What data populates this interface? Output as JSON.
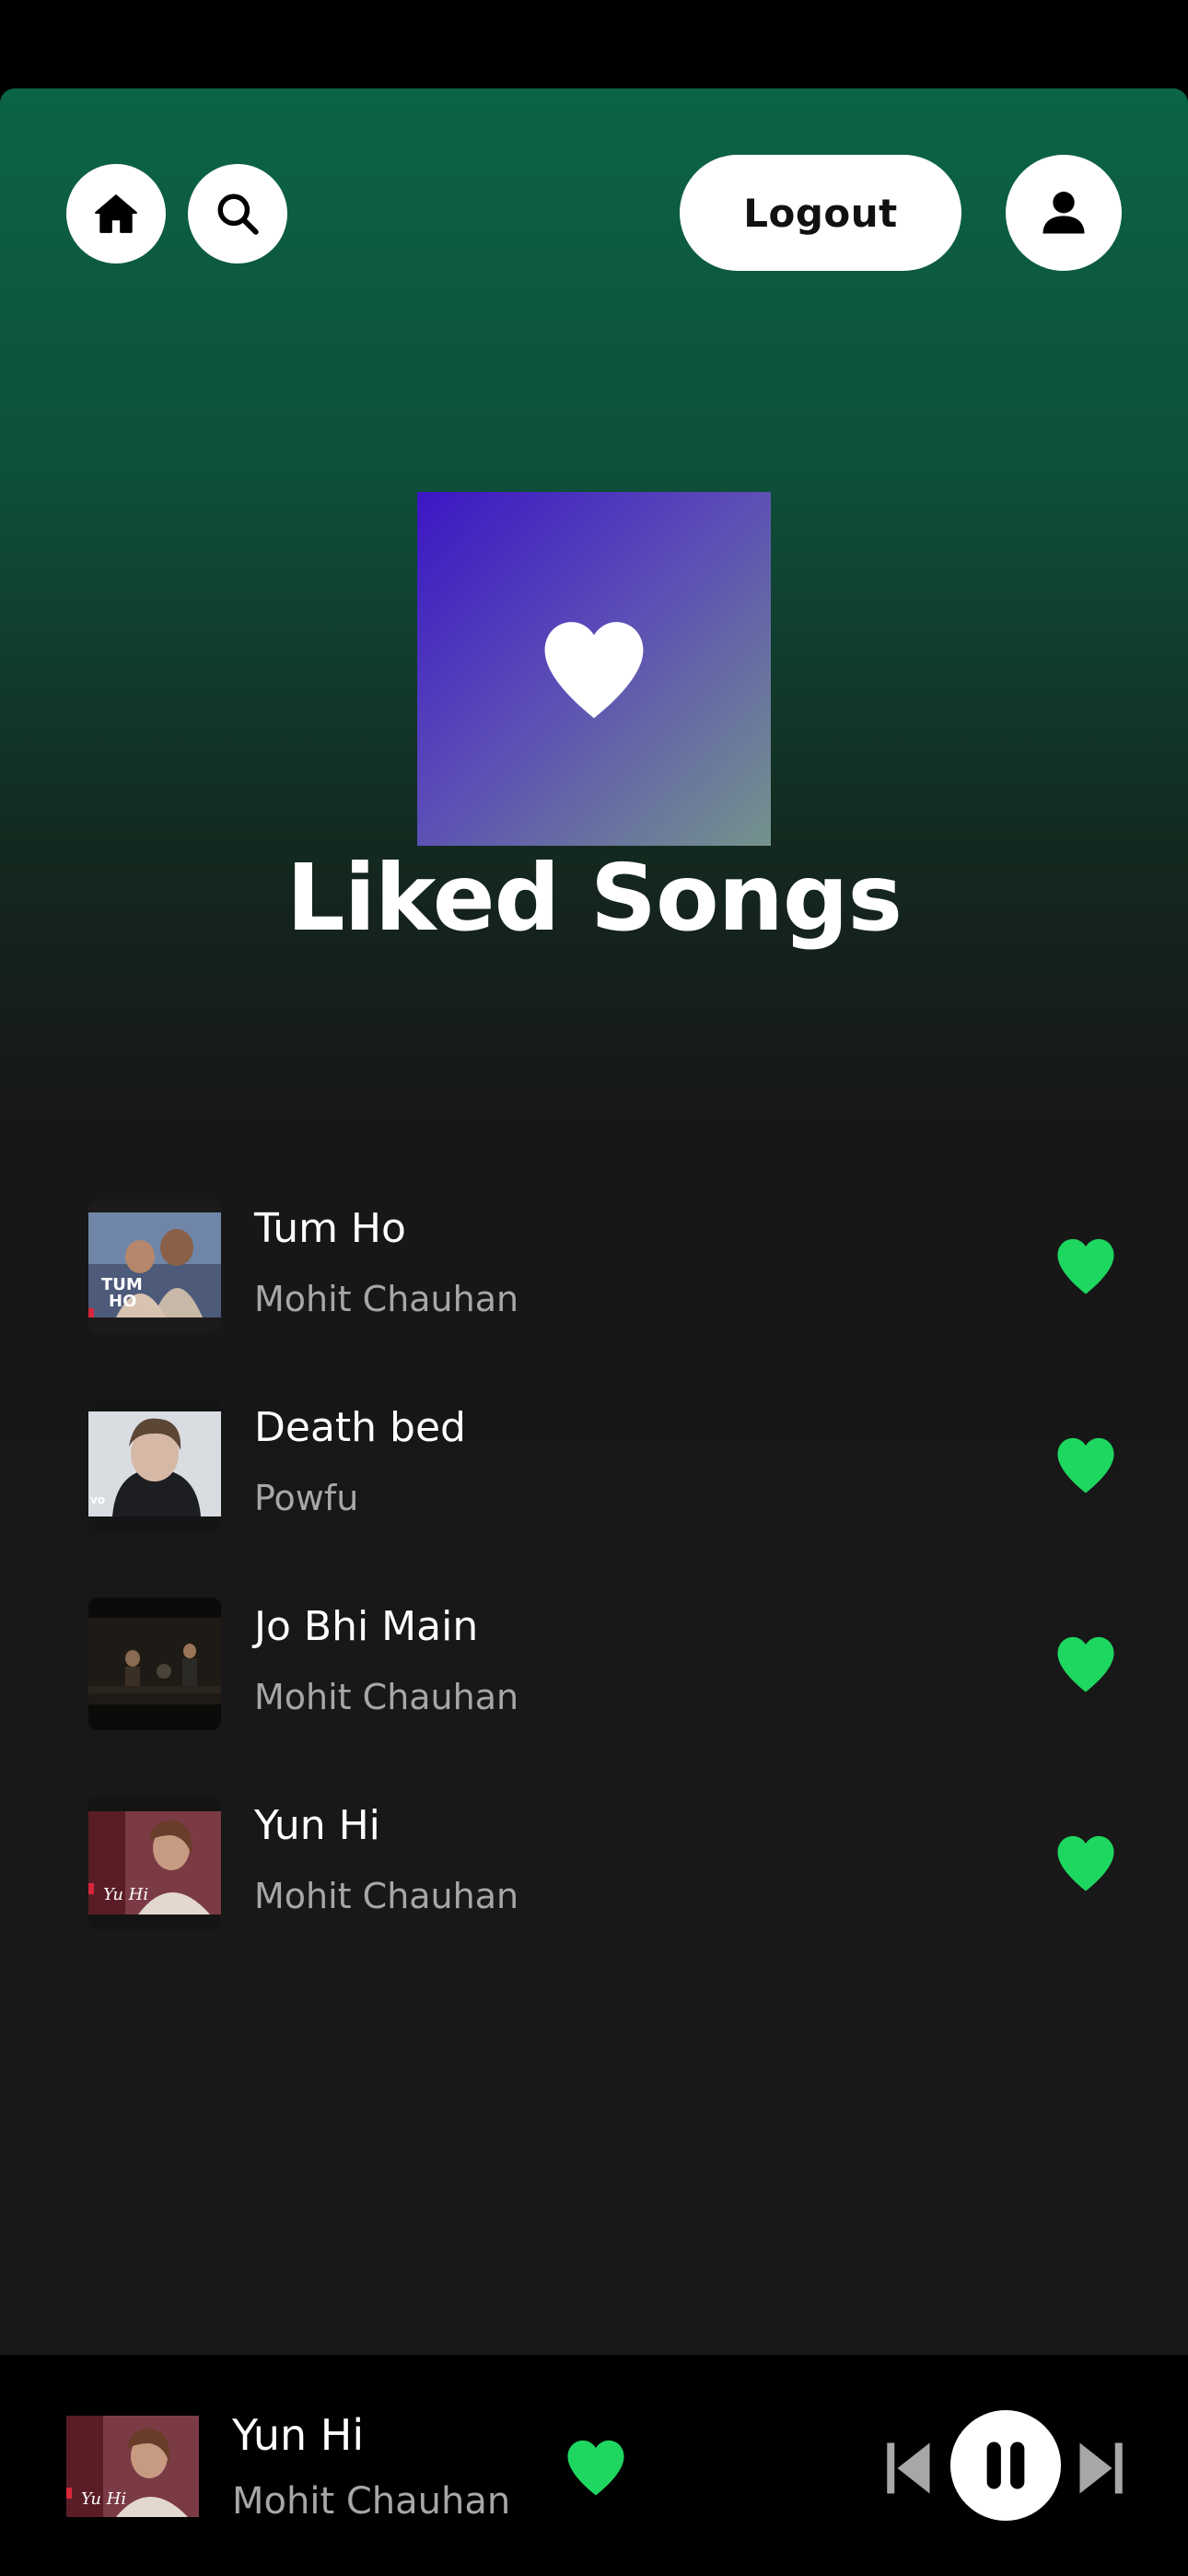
{
  "header": {
    "home_icon": "home-icon",
    "search_icon": "search-icon",
    "logout_label": "Logout",
    "profile_icon": "user-icon"
  },
  "playlist": {
    "title": "Liked Songs",
    "cover_icon": "heart-icon"
  },
  "songs": [
    {
      "title": "Tum Ho",
      "artist": "Mohit Chauhan",
      "liked": true
    },
    {
      "title": "Death bed",
      "artist": "Powfu",
      "liked": true
    },
    {
      "title": "Jo Bhi Main",
      "artist": "Mohit Chauhan",
      "liked": true
    },
    {
      "title": "Yun Hi",
      "artist": "Mohit Chauhan",
      "liked": true
    }
  ],
  "now_playing": {
    "title": "Yun Hi",
    "artist": "Mohit Chauhan",
    "liked": true,
    "state": "playing"
  },
  "colors": {
    "accent_green": "#1ed760",
    "header_green": "#0b6447",
    "background": "#181818",
    "secondary_text": "#a7a7a7"
  }
}
